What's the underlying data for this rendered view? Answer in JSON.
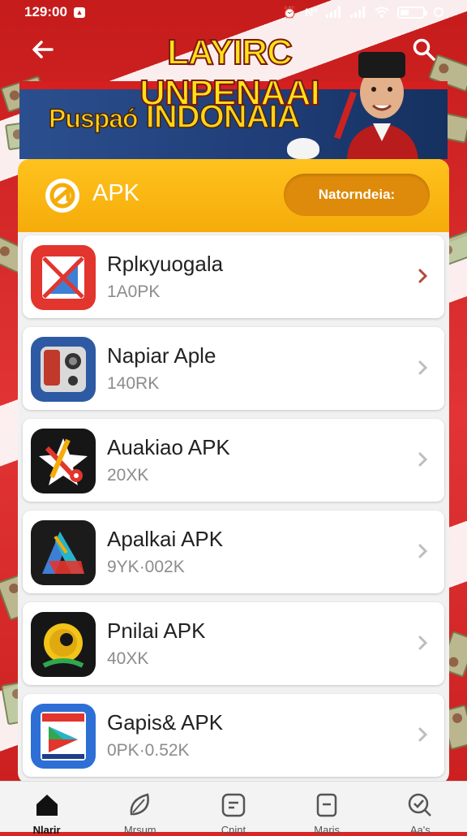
{
  "status_bar": {
    "time": "129:00",
    "right_text": "N°"
  },
  "header": {
    "title": "LAYIRC UNPENAAI"
  },
  "banner": {
    "line1": "Puspaó",
    "line2": "INDONAIA"
  },
  "panel": {
    "label": "APK",
    "action_label": "Natorndeia:"
  },
  "apps": [
    {
      "name": "Rplĸyuogala",
      "size": "1A0PK",
      "icon": "document-x-icon"
    },
    {
      "name": "Napiar Aple",
      "size": "140RK",
      "icon": "camera-device-icon"
    },
    {
      "name": "Auakiao APK",
      "size": "20XK",
      "icon": "star-pinwheel-icon"
    },
    {
      "name": "Apalkai APK",
      "size": "9YK·002K",
      "icon": "triangle-logo-icon"
    },
    {
      "name": "Pnilai APK",
      "size": "40XK",
      "icon": "yellow-coin-icon"
    },
    {
      "name": "Gapis& APK",
      "size": "0PK·0.52K",
      "icon": "play-store-icon"
    }
  ],
  "bottom_nav": [
    {
      "label": "Nlarir",
      "icon": "home-icon",
      "active": true
    },
    {
      "label": "Mrsum",
      "icon": "leaf-icon",
      "active": false
    },
    {
      "label": "Cnint",
      "icon": "square-dash-icon",
      "active": false
    },
    {
      "label": "Maris",
      "icon": "box-icon",
      "active": false
    },
    {
      "label": "Aa's",
      "icon": "search-check-icon",
      "active": false
    }
  ],
  "colors": {
    "header_red": "#d92525",
    "panel_yellow": "#ffc21e",
    "action_orange": "#de8a0a",
    "title_yellow": "#ffe21a"
  }
}
